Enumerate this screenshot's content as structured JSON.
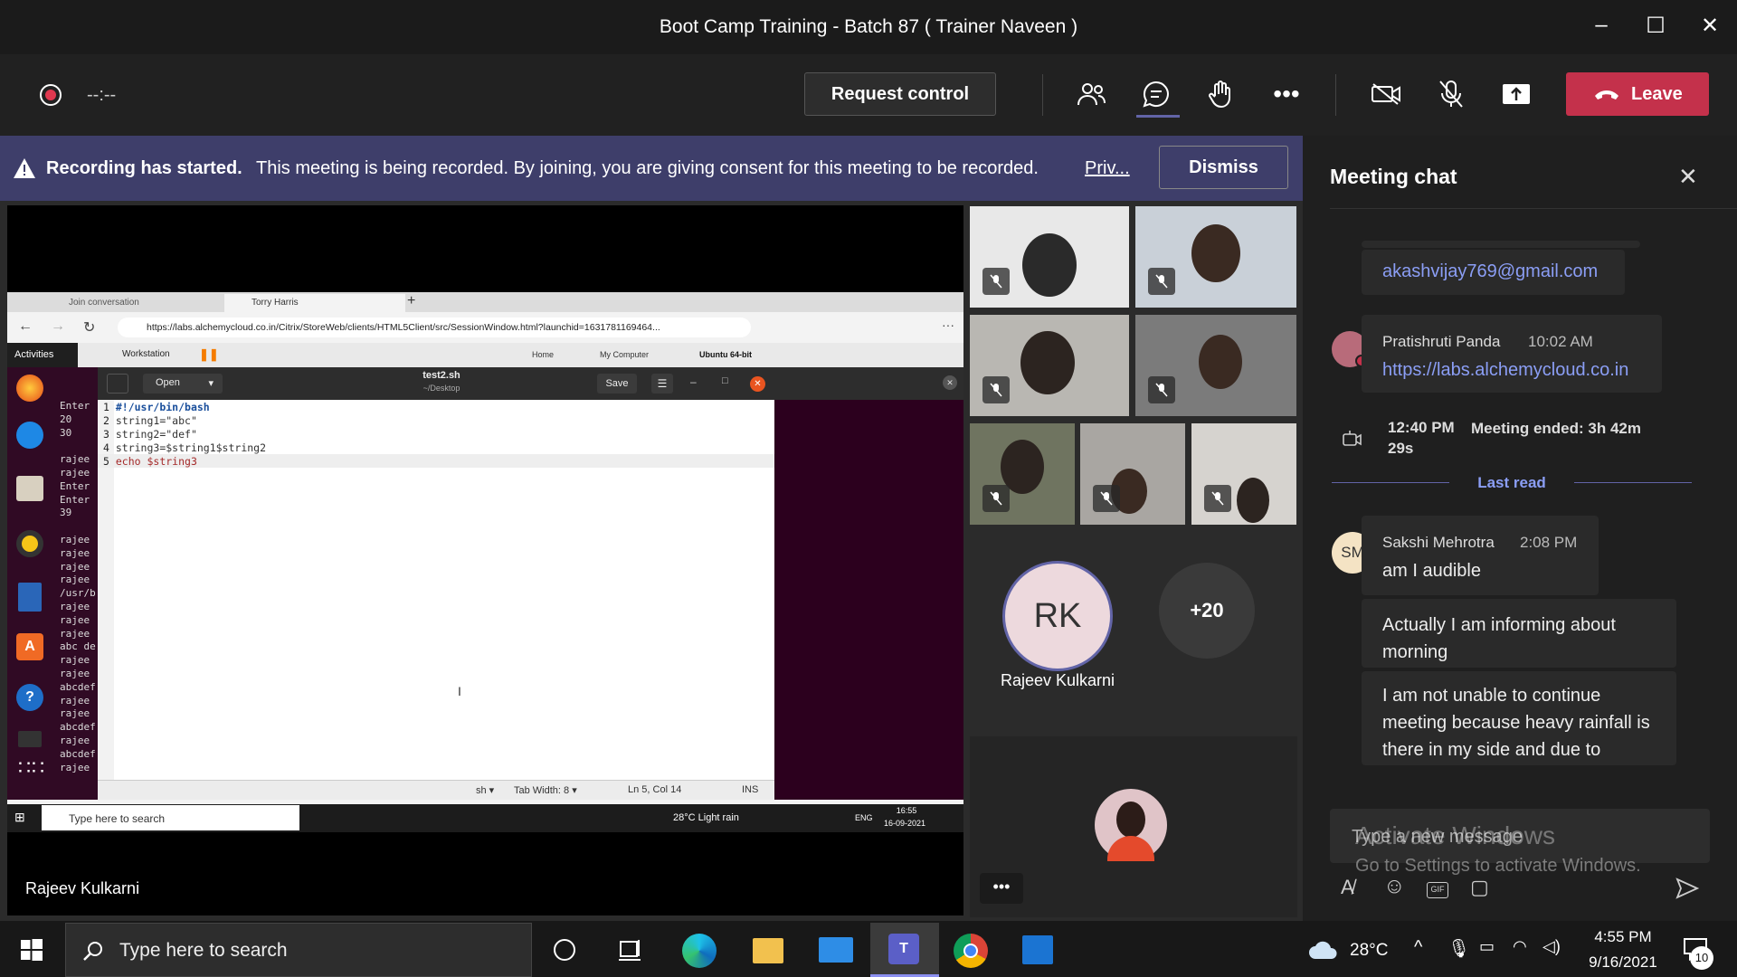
{
  "window": {
    "title": "Boot Camp Training - Batch 87 ( Trainer Naveen )"
  },
  "toolbar": {
    "timer": "--:--",
    "request_control": "Request control",
    "leave": "Leave"
  },
  "banner": {
    "bold": "Recording has started.",
    "text": "This meeting is being recorded. By joining, you are giving consent for this meeting to be recorded.",
    "link": "Priv...",
    "dismiss": "Dismiss"
  },
  "colors": {
    "accent": "#6264a7",
    "leave": "#c4314b",
    "banner": "#3e3e6a"
  },
  "shared": {
    "presenter": "Rajeev Kulkarni",
    "browser": {
      "tab1": "Join conversation",
      "tab2": "Torry Harris",
      "url": "https://labs.alchemycloud.co.in/Citrix/StoreWeb/clients/HTML5Client/src/SessionWindow.html?launchid=1631781169464...",
      "vm_toolbar": "Workstation",
      "vm_tabs": [
        "Home",
        "My Computer",
        "Ubuntu 64-bit"
      ]
    },
    "ubuntu": {
      "activities": "Activities"
    },
    "gedit": {
      "open": "Open",
      "filename": "test2.sh",
      "path": "~/Desktop",
      "save": "Save",
      "lines": [
        {
          "n": "1",
          "text": "#!/usr/bin/bash"
        },
        {
          "n": "2",
          "text": "string1=\"abc\""
        },
        {
          "n": "3",
          "text": "string2=\"def\""
        },
        {
          "n": "4",
          "text": "string3=$string1$string2"
        },
        {
          "n": "5",
          "text": "echo $string3"
        }
      ],
      "status": {
        "lang": "sh ▾",
        "tab": "Tab Width: 8 ▾",
        "pos": "Ln 5, Col 14",
        "ins": "INS"
      }
    },
    "terminal_lines": [
      "Enter",
      "20",
      "30",
      "",
      "rajee",
      "rajee",
      "Enter",
      "Enter",
      "39",
      "",
      "rajee",
      "rajee",
      "rajee",
      "rajee",
      "/usr/b",
      "rajee",
      "rajee",
      "rajee",
      "abc de",
      "rajee",
      "rajee",
      "abcdef",
      "rajee",
      "rajee",
      "abcdef",
      "rajee",
      "abcdef",
      "rajee"
    ],
    "win_taskbar": {
      "search": "Type here to search",
      "weather": "28°C  Light rain",
      "lang": "ENG",
      "time": "16:55",
      "date": "16-09-2021"
    }
  },
  "participants": {
    "rk_initials": "RK",
    "rk_name": "Rajeev Kulkarni",
    "more": "+20"
  },
  "chat": {
    "title": "Meeting chat",
    "email": "akashvijay769@gmail.com",
    "msg1": {
      "sender": "Pratishruti Panda",
      "time": "10:02 AM",
      "link": "https://labs.alchemycloud.co.in"
    },
    "event": {
      "time": "12:40 PM",
      "text": "Meeting ended: 3h 42m 29s"
    },
    "last_read": "Last read",
    "msg2": {
      "initials": "SM",
      "sender": "Sakshi Mehrotra",
      "time": "2:08 PM",
      "text": "am I audible"
    },
    "msg3": "Actually I am informing about morning",
    "msg4": "I am not unable to continue meeting because heavy rainfall is there in my side and due to",
    "compose_placeholder": "Type a new message",
    "watermark1": "Activate Windows",
    "watermark2": "Go to Settings to activate Windows."
  },
  "taskbar": {
    "search": "Type here to search",
    "weather": "28°C",
    "time": "4:55 PM",
    "date": "9/16/2021",
    "notif": "10"
  }
}
